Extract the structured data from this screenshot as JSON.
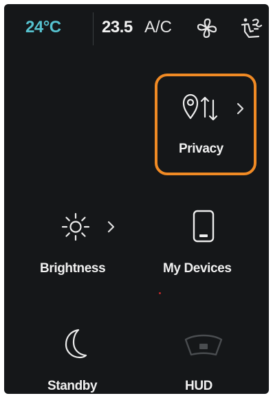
{
  "status_bar": {
    "outside_temp": "24°C",
    "cabin_temp": "23.5",
    "ac_label": "A/C",
    "fan_icon": "fan-icon",
    "airflow_icon": "airflow-icon"
  },
  "tiles": {
    "privacy": {
      "label": "Privacy",
      "icon": "location-transfer-icon",
      "has_chevron": true,
      "highlighted": true
    },
    "brightness": {
      "label": "Brightness",
      "icon": "sun-icon",
      "has_chevron": true
    },
    "my_devices": {
      "label": "My Devices",
      "icon": "phone-icon"
    },
    "standby": {
      "label": "Standby",
      "icon": "moon-icon"
    },
    "hud": {
      "label": "HUD",
      "icon": "windshield-icon"
    }
  },
  "colors": {
    "background": "#151719",
    "outside_temp": "#56c2cf",
    "highlight": "#f08a24"
  }
}
